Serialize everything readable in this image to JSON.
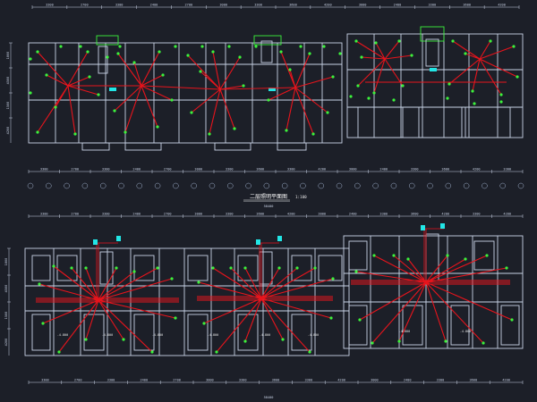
{
  "drawing": {
    "title": "二层照明平面图",
    "scale": "1:100",
    "colors": {
      "background": "#1c1f28",
      "wall": "#c9d3e6",
      "wiring": "#e8141c",
      "fixture": "#3cf23c",
      "riser": "#22e6e6"
    }
  },
  "top_plan": {
    "dims_top": [
      "3300",
      "2700",
      "3300",
      "2400",
      "2700",
      "3000",
      "3300",
      "3600",
      "4200",
      "3000",
      "2400",
      "3300",
      "3600",
      "4200"
    ],
    "dims_bottom": [
      "3300",
      "2700",
      "3300",
      "2400",
      "2700",
      "3000",
      "3300",
      "3600",
      "3300",
      "4200",
      "3000",
      "2400",
      "3300",
      "3600",
      "4200",
      "3300"
    ],
    "dims_left": [
      "1800",
      "4500",
      "1500",
      "4200"
    ],
    "overall": "58400"
  },
  "bottom_plan": {
    "dims_top": [
      "3300",
      "2700",
      "3300",
      "2400",
      "2700",
      "3000",
      "3300",
      "3600",
      "4200",
      "3000",
      "2400",
      "3300",
      "3600",
      "4200",
      "3300",
      "4200"
    ],
    "dims_bottom": [
      "3300",
      "2700",
      "3300",
      "2400",
      "2700",
      "3000",
      "3300",
      "3600",
      "3300",
      "4200",
      "3000",
      "2400",
      "3300",
      "3600",
      "4200"
    ],
    "dims_left": [
      "1800",
      "4500",
      "1500",
      "4200"
    ],
    "overall": "58400",
    "annotations": [
      "-4.800",
      "-4.800",
      "-4.800",
      "-4.800",
      "-4.800",
      "-4.800",
      "-4.800",
      "-4.800"
    ]
  }
}
